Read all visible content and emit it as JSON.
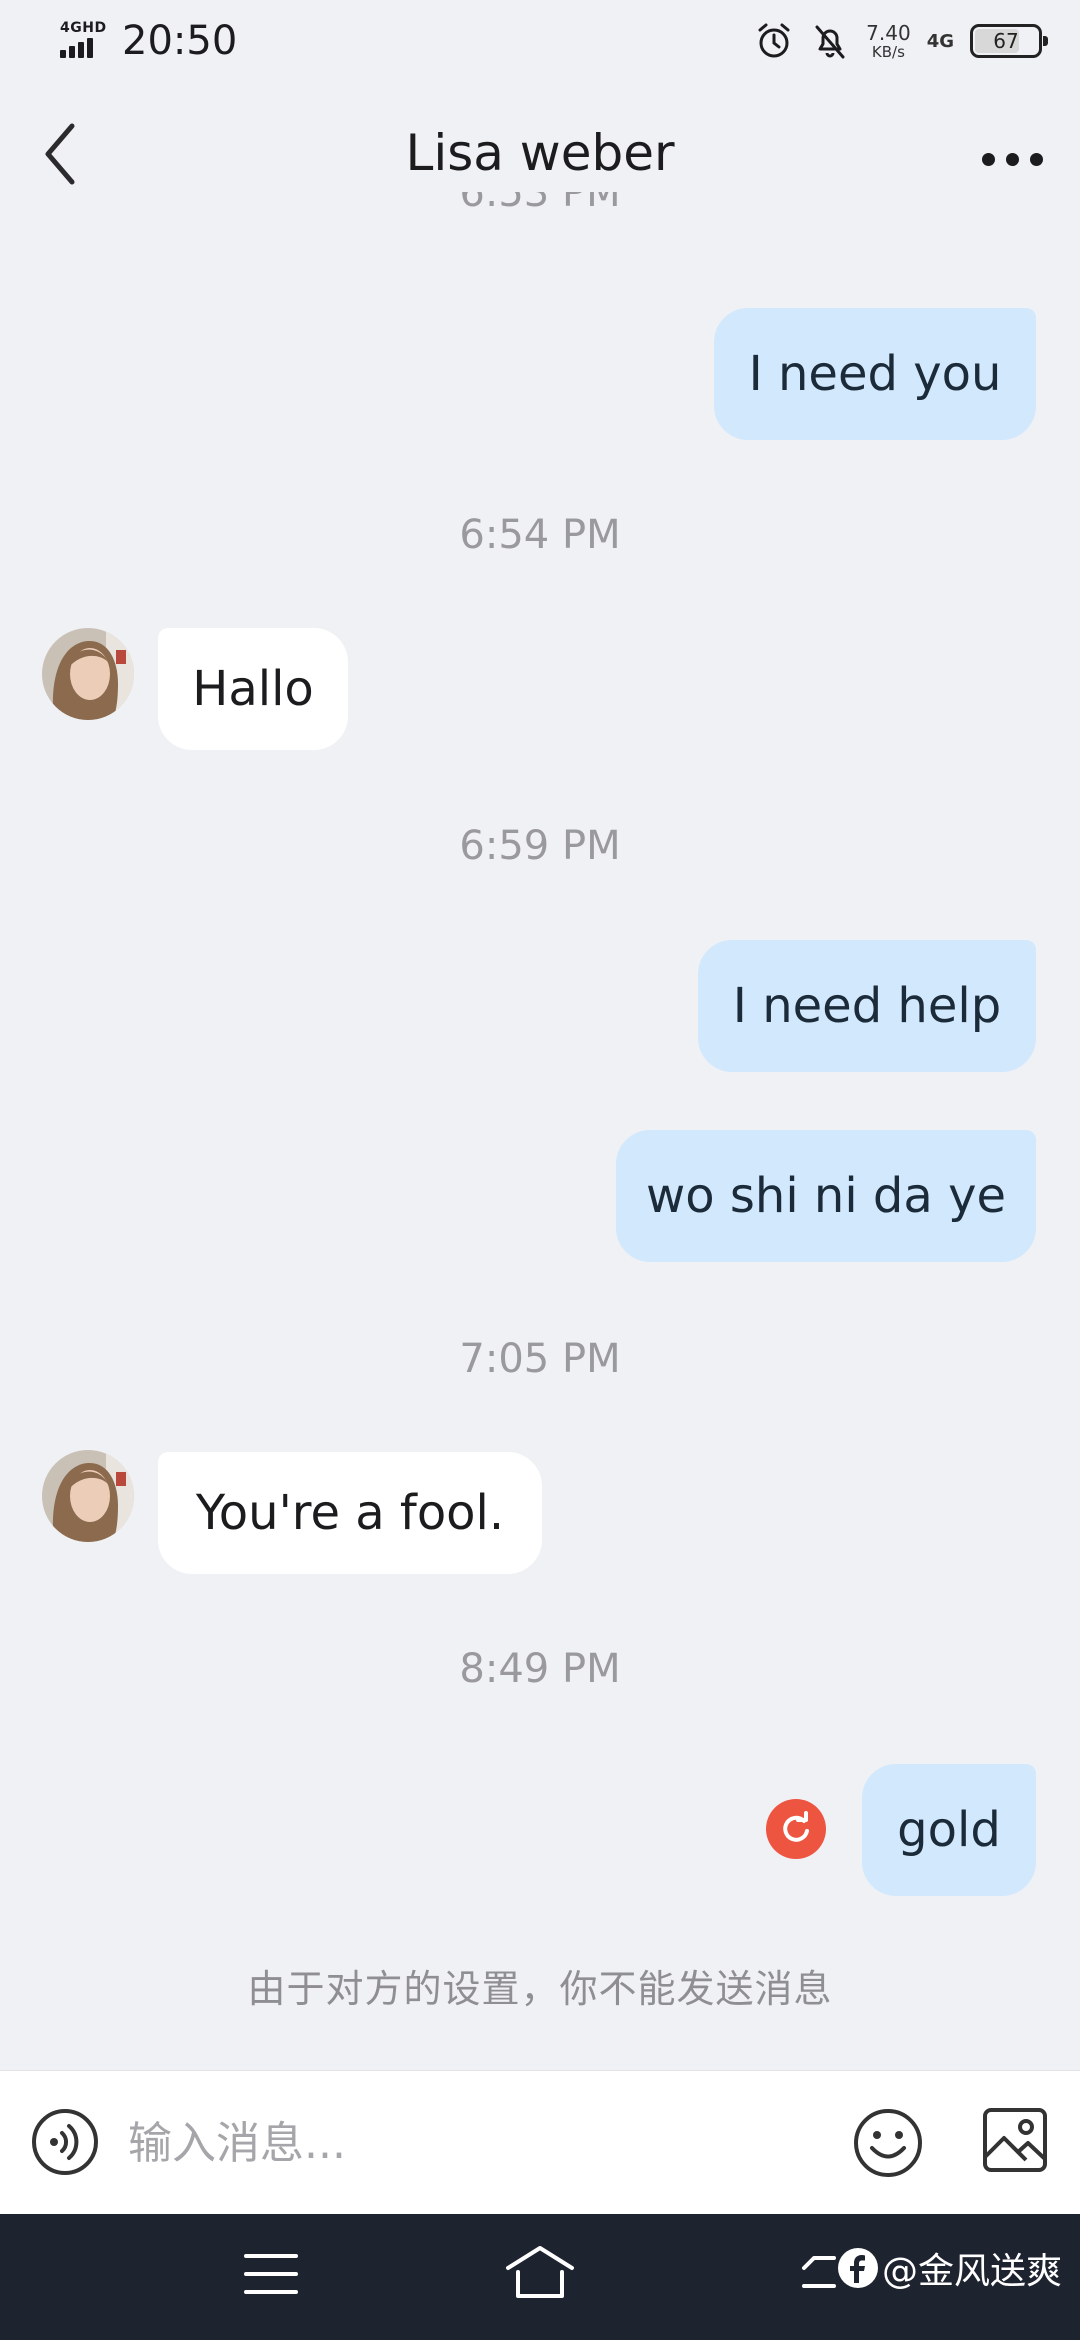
{
  "status_bar": {
    "network_label": "4GHD",
    "time": "20:50",
    "speed_value": "7.40",
    "speed_unit": "KB/s",
    "network_type": "4G",
    "battery": "67",
    "battery_level": 0.67
  },
  "header": {
    "title": "Lisa weber"
  },
  "messages": [
    {
      "kind": "timestamp",
      "text": "6:53 PM",
      "partially_hidden": true
    },
    {
      "kind": "bubble",
      "direction": "outgoing",
      "text": "I need you"
    },
    {
      "kind": "timestamp",
      "text": "6:54 PM"
    },
    {
      "kind": "bubble",
      "direction": "incoming",
      "text": "Hallo"
    },
    {
      "kind": "timestamp",
      "text": "6:59 PM"
    },
    {
      "kind": "bubble",
      "direction": "outgoing",
      "text": "I need help"
    },
    {
      "kind": "bubble",
      "direction": "outgoing",
      "text": "wo shi ni da ye"
    },
    {
      "kind": "timestamp",
      "text": "7:05 PM"
    },
    {
      "kind": "bubble",
      "direction": "incoming",
      "text": "You're a fool."
    },
    {
      "kind": "timestamp",
      "text": "8:49 PM"
    },
    {
      "kind": "bubble",
      "direction": "outgoing",
      "text": "gold",
      "status": "failed"
    }
  ],
  "notice": "由于对方的设置，你不能发送消息",
  "input": {
    "placeholder": "输入消息..."
  },
  "watermark": {
    "text": "@金风送爽"
  },
  "colors": {
    "background": "#f0f1f5",
    "outgoing_bubble": "#d2e8fd",
    "incoming_bubble": "#ffffff",
    "failed_indicator": "#ee5541",
    "nav_bar": "#1e2330"
  },
  "icons": [
    "alarm-icon",
    "muted-bell-icon",
    "back-arrow-icon",
    "more-dots-icon",
    "retry-icon",
    "voice-icon",
    "emoji-icon",
    "image-icon",
    "menu-icon",
    "home-icon",
    "back-nav-icon",
    "facebook-icon"
  ]
}
